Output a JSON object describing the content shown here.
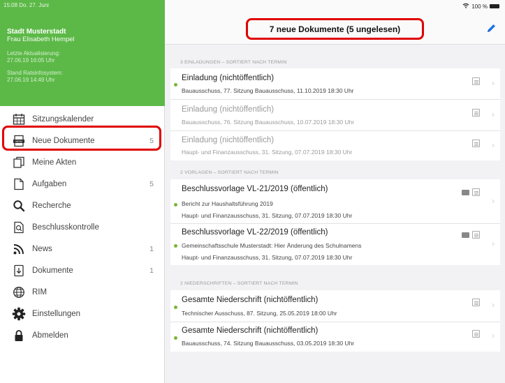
{
  "status_bar": {
    "time_date": "15:08 Do. 27. Juni",
    "battery": "100 %"
  },
  "sidebar": {
    "city": "Stadt Musterstadt",
    "user": "Frau Elisabeth Hempel",
    "sync_label": "Letzte Aktualisierung:",
    "sync_value": "27.06.19 16:05 Uhr",
    "system_label": "Stand Ratsinfosystem:",
    "system_value": "27.06.19 14:49 Uhr",
    "items": [
      {
        "label": "Sitzungskalender",
        "count": "",
        "icon": "calendar-icon"
      },
      {
        "label": "Neue Dokumente",
        "count": "5",
        "icon": "new-documents-icon"
      },
      {
        "label": "Meine Akten",
        "count": "",
        "icon": "files-icon"
      },
      {
        "label": "Aufgaben",
        "count": "5",
        "icon": "task-icon"
      },
      {
        "label": "Recherche",
        "count": "",
        "icon": "search-icon"
      },
      {
        "label": "Beschlusskontrolle",
        "count": "",
        "icon": "resolution-check-icon"
      },
      {
        "label": "News",
        "count": "1",
        "icon": "rss-icon"
      },
      {
        "label": "Dokumente",
        "count": "1",
        "icon": "document-download-icon"
      },
      {
        "label": "RIM",
        "count": "",
        "icon": "globe-icon"
      },
      {
        "label": "Einstellungen",
        "count": "",
        "icon": "gear-icon"
      },
      {
        "label": "Abmelden",
        "count": "",
        "icon": "lock-icon"
      }
    ]
  },
  "main": {
    "title": "7 neue Dokumente (5 ungelesen)",
    "sections": [
      {
        "label": "3 EINLADUNGEN – SORTIERT NACH TERMIN",
        "rows": [
          {
            "title": "Einladung (nichtöffentlich)",
            "sub": "Bauausschuss, 77. Sitzung Bauausschuss, 11.10.2019 18:30 Uhr",
            "unread": true
          },
          {
            "title": "Einladung (nichtöffentlich)",
            "sub": "Bauausschuss, 76. Sitzung Bauausschuss, 10.07.2019 18:30 Uhr",
            "unread": false
          },
          {
            "title": "Einladung (nichtöffentlich)",
            "sub": "Haupt- und Finanzausschuss, 31. Sitzung, 07.07.2019 18:30 Uhr",
            "unread": false
          }
        ]
      },
      {
        "label": "2 VORLAGEN – SORTIERT NACH TERMIN",
        "rows": [
          {
            "title": "Beschlussvorlage VL-21/2019 (öffentlich)",
            "sub1": "Bericht zur Haushaltsführung 2019",
            "sub2": "Haupt- und Finanzausschuss, 31. Sitzung, 07.07.2019 18:30 Uhr",
            "unread": true
          },
          {
            "title": "Beschlussvorlage VL-22/2019 (öffentlich)",
            "sub1": "Gemeinschaftsschule Musterstadt: Hier Änderung des Schulnamens",
            "sub2": "Haupt- und Finanzausschuss, 31. Sitzung, 07.07.2019 18:30 Uhr",
            "unread": true
          }
        ]
      },
      {
        "label": "2 NIEDERSCHRIFTEN – SORTIERT NACH TERMIN",
        "rows": [
          {
            "title": "Gesamte Niederschrift (nichtöffentlich)",
            "sub": "Technischer Ausschuss, 87. Sitzung, 25.05.2019 18:00 Uhr",
            "unread": true
          },
          {
            "title": "Gesamte Niederschrift (nichtöffentlich)",
            "sub": "Bauausschuss, 74. Sitzung Bauausschuss, 03.05.2019 18:30 Uhr",
            "unread": true
          }
        ]
      }
    ]
  },
  "colors": {
    "accent_green": "#5cb947",
    "highlight_red": "#e00000",
    "edit_blue": "#1a73e8"
  }
}
